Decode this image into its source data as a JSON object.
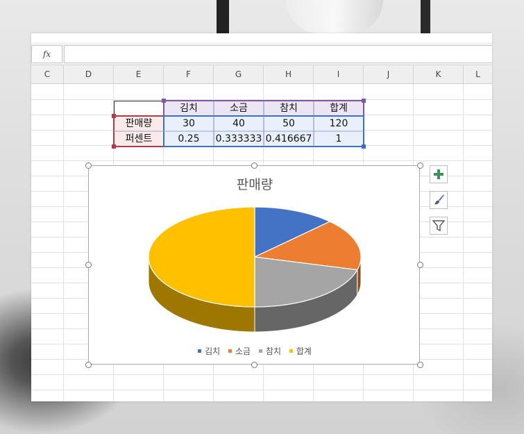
{
  "formula_bar": {
    "fx_label": "fx",
    "value": ""
  },
  "columns": [
    "C",
    "D",
    "E",
    "F",
    "G",
    "H",
    "I",
    "J",
    "K",
    "L"
  ],
  "table": {
    "headers": [
      "김치",
      "소금",
      "참치",
      "합계"
    ],
    "rows": [
      {
        "label": "판매량",
        "values": [
          "30",
          "40",
          "50",
          "120"
        ]
      },
      {
        "label": "퍼센트",
        "values": [
          "0.25",
          "0.333333",
          "0.416667",
          "1"
        ]
      }
    ]
  },
  "chart_data": {
    "type": "pie",
    "title": "판매량",
    "categories": [
      "김치",
      "소금",
      "참치",
      "합계"
    ],
    "values": [
      30,
      40,
      50,
      120
    ],
    "colors": [
      "#4472c4",
      "#ed7d31",
      "#a5a5a5",
      "#ffc000"
    ],
    "legend_position": "bottom",
    "style": "3d"
  },
  "chart_buttons": {
    "add_icon": "plus-icon",
    "style_icon": "paintbrush-icon",
    "filter_icon": "filter-icon"
  }
}
